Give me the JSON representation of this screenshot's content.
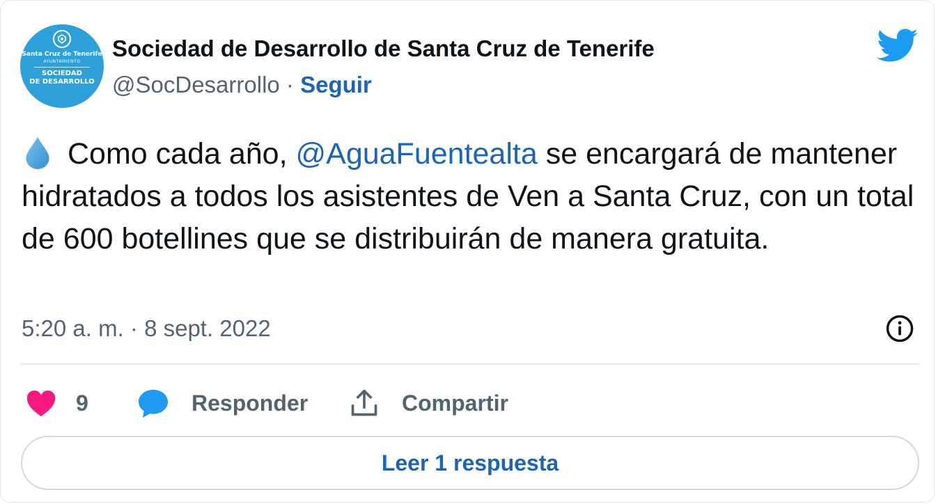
{
  "author": {
    "name": "Sociedad de Desarrollo de Santa Cruz de Tenerife",
    "handle": "@SocDesarrollo",
    "separator": " · ",
    "follow_label": "Seguir",
    "avatar": {
      "line1": "Santa Cruz de Tenerife",
      "line2": "AYUNTAMIENTO",
      "line3": "SOCIEDAD",
      "line4": "DE DESARROLLO",
      "color": "#2d9fd9"
    }
  },
  "tweet": {
    "text_before": "Como cada año, ",
    "mention": "@AguaFuentealta",
    "text_after": " se encargará de mantener hidratados a todos los asistentes de Ven a Santa Cruz, con un total de 600 botellines que se distribuirán de manera gratuita.",
    "emoji": "droplet-icon"
  },
  "timestamp": "5:20 a. m. · 8 sept. 2022",
  "actions": {
    "like_count": "9",
    "reply_label": "Responder",
    "share_label": "Compartir"
  },
  "read_replies_label": "Leer 1 respuesta",
  "colors": {
    "link": "#1b64b8",
    "twitter_blue": "#1d9bf0",
    "heart": "#f91880",
    "secondary_text": "#536471"
  }
}
